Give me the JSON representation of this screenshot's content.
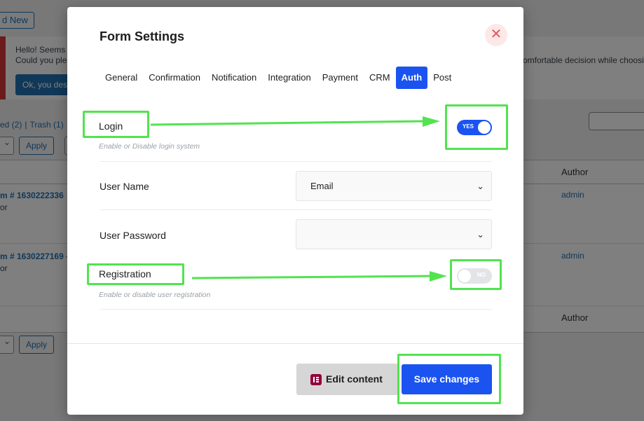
{
  "background": {
    "add_new": "d New",
    "notice": {
      "line1": "Hello! Seems l",
      "line2": "Could you plea",
      "line2_right": "omfortable decision while choosin",
      "button": "Ok, you dese"
    },
    "views": {
      "published": "ed (2)",
      "separator": "|",
      "trash": "Trash (1)"
    },
    "apply": "Apply",
    "author_header": "Author",
    "rows": [
      {
        "title": "m # 1630222336",
        "sub": "or",
        "author": "admin"
      },
      {
        "title": "m # 1630227169 -",
        "sub": "or",
        "author": "admin"
      }
    ]
  },
  "modal": {
    "title": "Form Settings",
    "close_glyph": "✕",
    "tabs": [
      {
        "label": "General",
        "active": false
      },
      {
        "label": "Confirmation",
        "active": false
      },
      {
        "label": "Notification",
        "active": false
      },
      {
        "label": "Integration",
        "active": false
      },
      {
        "label": "Payment",
        "active": false
      },
      {
        "label": "CRM",
        "active": false
      },
      {
        "label": "Auth",
        "active": true
      },
      {
        "label": "Post",
        "active": false
      }
    ],
    "login": {
      "label": "Login",
      "help": "Enable or Disable login system",
      "toggle_label": "YES",
      "enabled": true
    },
    "user_name": {
      "label": "User Name",
      "value": "Email"
    },
    "user_password": {
      "label": "User Password",
      "value": ""
    },
    "registration": {
      "label": "Registration",
      "help": "Enable or disable user registration",
      "toggle_label": "NO",
      "enabled": false
    },
    "edit_content": "Edit content",
    "save_changes": "Save changes"
  },
  "colors": {
    "primary": "#1a53f0",
    "highlight": "#52e34f",
    "close": "#e05a5a",
    "elementor": "#92003b"
  },
  "icons": {
    "close": "close-icon",
    "chevron": "chevron-down-icon",
    "elementor": "elementor-icon"
  }
}
